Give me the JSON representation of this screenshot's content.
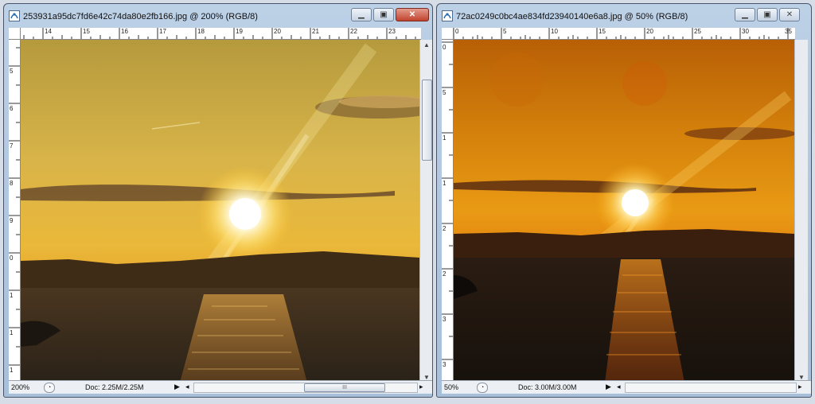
{
  "windows": [
    {
      "title": "253931a95dc7fd6e42c74da80e2fb166.jpg @ 200% (RGB/8)",
      "ruler_h": [
        "14",
        "15",
        "16",
        "17",
        "18",
        "19",
        "20",
        "21",
        "22",
        "23"
      ],
      "ruler_v": [
        "5",
        "6",
        "7",
        "8",
        "9",
        "0",
        "1",
        "1",
        "1"
      ],
      "status": {
        "zoom": "200%",
        "doc": "Doc: 2.25M/2.25M"
      },
      "hscroll_thumb": "III"
    },
    {
      "title": "72ac0249c0bc4ae834fd23940140e6a8.jpg @ 50% (RGB/8)",
      "ruler_h": [
        "0",
        "5",
        "10",
        "15",
        "20",
        "25",
        "30",
        "35"
      ],
      "ruler_v": [
        "0",
        "5",
        "1",
        "1",
        "2",
        "2",
        "3",
        "3"
      ],
      "status": {
        "zoom": "50%",
        "doc": "Doc: 3.00M/3.00M"
      }
    }
  ],
  "icons": {
    "app": "photoshop-doc-icon",
    "minimize": "minimize-icon",
    "maximize": "maximize-icon",
    "close": "close-icon"
  }
}
